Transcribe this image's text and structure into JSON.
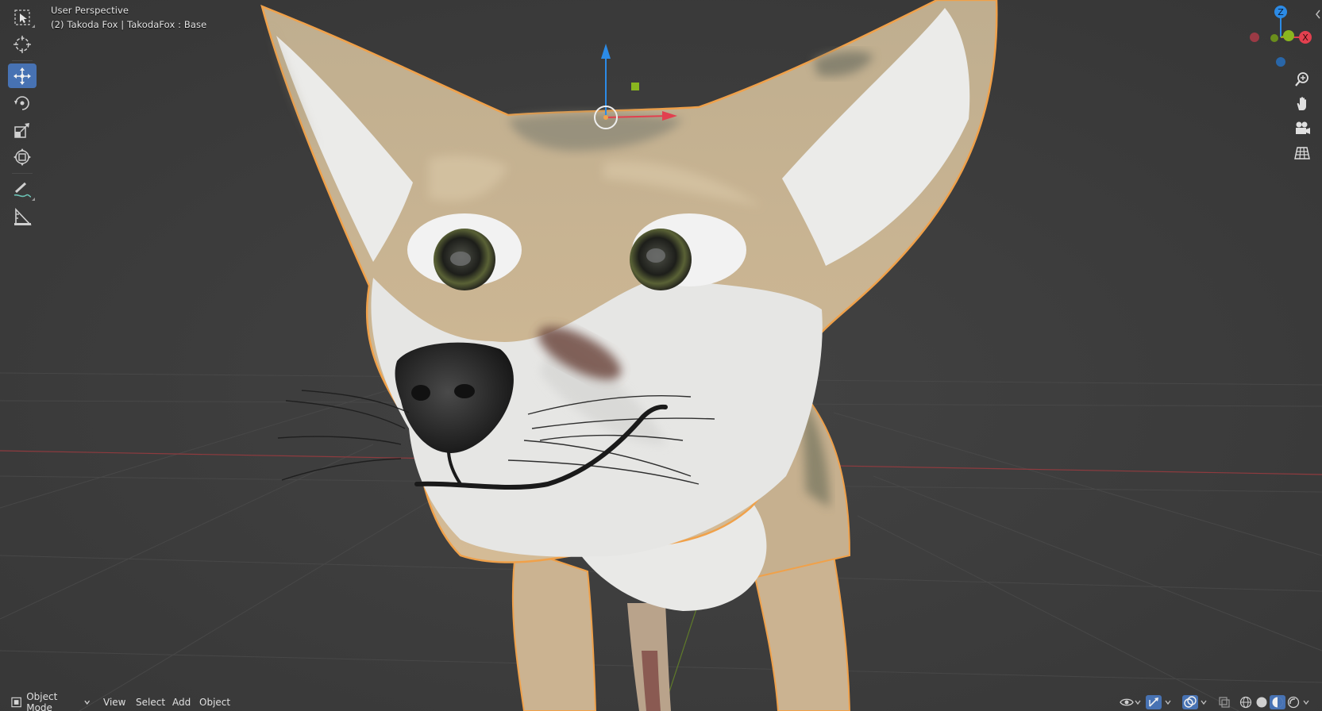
{
  "viewport": {
    "view_name": "User Perspective",
    "object_info": "(2) Takoda Fox | TakodaFox : Base"
  },
  "toolbar": {
    "tools": [
      {
        "name": "select-box-icon",
        "active": false
      },
      {
        "name": "cursor-icon",
        "active": false
      },
      {
        "name": "move-icon",
        "active": true
      },
      {
        "name": "rotate-icon",
        "active": false
      },
      {
        "name": "scale-icon",
        "active": false
      },
      {
        "name": "transform-icon",
        "active": false
      },
      {
        "name": "annotate-icon",
        "active": false
      },
      {
        "name": "measure-icon",
        "active": false
      }
    ]
  },
  "gizmo": {
    "z_label": "Z",
    "x_label": "X",
    "colors": {
      "x": "#e2404f",
      "y": "#8ab61f",
      "z": "#2c8be6"
    }
  },
  "header_bottom": {
    "mode_label": "Object Mode",
    "menus": [
      "View",
      "Select",
      "Add",
      "Object"
    ]
  },
  "colors": {
    "background": "#3d3d3d",
    "active_tool": "#4772b3",
    "selection_outline": "#f0a14a",
    "fur_tan": "#cdb594",
    "fur_white": "#e8e8e6"
  }
}
